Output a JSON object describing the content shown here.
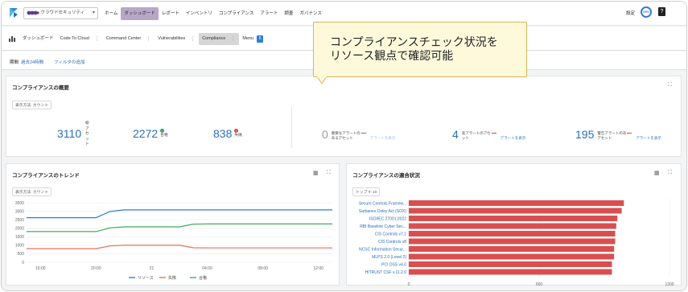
{
  "nav": {
    "org": "クラウドセキュリティ",
    "items": [
      "ホーム",
      "ダッシュボード",
      "レポート",
      "インベントリ",
      "コンプライアンス",
      "アラート",
      "調査",
      "ガバナンス"
    ],
    "settings": "設定",
    "avatar_text": "29%",
    "help": "?"
  },
  "tabbar": {
    "title": "ダッシュボード",
    "tabs": [
      "Code To Cloud",
      "Command Center",
      "Vulnerabilities",
      "Compliance"
    ],
    "menu_label": "Menu",
    "menu_count": "5"
  },
  "filterbar": {
    "label": "期間",
    "period": "過去24時間",
    "add_filter": "フィルタの追加"
  },
  "callout": {
    "line1": "コンプライアンスチェック状況を",
    "line2": "リソース観点で確認可能"
  },
  "overview": {
    "title": "コンプライアンスの概要",
    "view_chip": "表示方法: カウント",
    "total_value": "3110",
    "total_label": "総アセット",
    "pass_value": "2272",
    "pass_label": "合格",
    "fail_value": "838",
    "fail_label": "失敗",
    "alerts": [
      {
        "value": "0",
        "line1": "重要なアラートの",
        "line2": "あるアセット",
        "link": "アラートを表示"
      },
      {
        "value": "4",
        "line1": "高アラートのアセ",
        "line2": "ット",
        "link": "アラートを表示"
      },
      {
        "value": "195",
        "line1": "警告アラートのあ",
        "line2": "アセット",
        "link": "アラートを表示"
      }
    ]
  },
  "trend": {
    "title": "コンプライアンスのトレンド",
    "view_chip": "表示方法: カウント",
    "legend": [
      "リソース",
      "失敗",
      "合格"
    ]
  },
  "fit": {
    "title": "コンプライアンスの適合状況",
    "top_chip": "トップ #: 10"
  },
  "chart_data": [
    {
      "type": "line",
      "title": "コンプライアンスのトレンド",
      "x": [
        "15:00",
        "16:00",
        "17:00",
        "18:00",
        "19:00",
        "20:00",
        "21:00",
        "22:00",
        "23:00",
        "21",
        "01:00",
        "02:00",
        "03:00",
        "04:00",
        "05:00",
        "06:00",
        "07:00",
        "08:00",
        "09:00",
        "10:00",
        "11:00",
        "12:00",
        "13:00"
      ],
      "x_tick_labels": [
        "16:00",
        "20:00",
        "21",
        "04:00",
        "08:00",
        "12:00"
      ],
      "ylim": [
        0,
        3500
      ],
      "y_ticks": [
        0,
        500,
        1000,
        1500,
        2000,
        2500,
        3000,
        3500
      ],
      "series": [
        {
          "name": "リソース",
          "color": "#2f7fd0",
          "values": [
            2620,
            2620,
            2620,
            2620,
            2620,
            2620,
            2980,
            3080,
            3080,
            3080,
            3080,
            3080,
            3080,
            3080,
            3080,
            3080,
            3080,
            3080,
            3080,
            3080,
            3080,
            3080,
            3080
          ]
        },
        {
          "name": "失敗",
          "color": "#e3735a",
          "values": [
            800,
            800,
            800,
            800,
            800,
            800,
            960,
            1000,
            1000,
            1000,
            1000,
            1000,
            850,
            840,
            840,
            840,
            840,
            840,
            840,
            840,
            840,
            840,
            840
          ]
        },
        {
          "name": "合格",
          "color": "#3fae5c",
          "values": [
            1800,
            1800,
            1800,
            1800,
            1800,
            1800,
            2020,
            2080,
            2080,
            2080,
            2080,
            2080,
            2240,
            2250,
            2250,
            2250,
            2250,
            2250,
            2250,
            2250,
            2250,
            2250,
            2250
          ]
        }
      ]
    },
    {
      "type": "bar",
      "orientation": "horizontal",
      "title": "コンプライアンスの適合状況",
      "categories": [
        "Secure Controls Framew...",
        "Sarbanes Oxley Act (SOX)",
        "ISO/IEC 27001:2022",
        "RBI Baseline Cyber Sec...",
        "CIS Controls v7.1",
        "CIS Controls v8",
        "NCSC Information Secur...",
        "MLPS 2.0 (Level 2)",
        "PCI DSS v4.0",
        "HITRUST CSF v.11.2.0"
      ],
      "values": [
        990,
        980,
        960,
        955,
        950,
        950,
        945,
        945,
        935,
        935
      ],
      "color": "#d94f4f",
      "xlim": [
        0,
        1200
      ],
      "x_ticks": [
        0,
        600,
        1200
      ],
      "x_tick_labels": [
        "0",
        "600",
        "1200"
      ]
    }
  ]
}
